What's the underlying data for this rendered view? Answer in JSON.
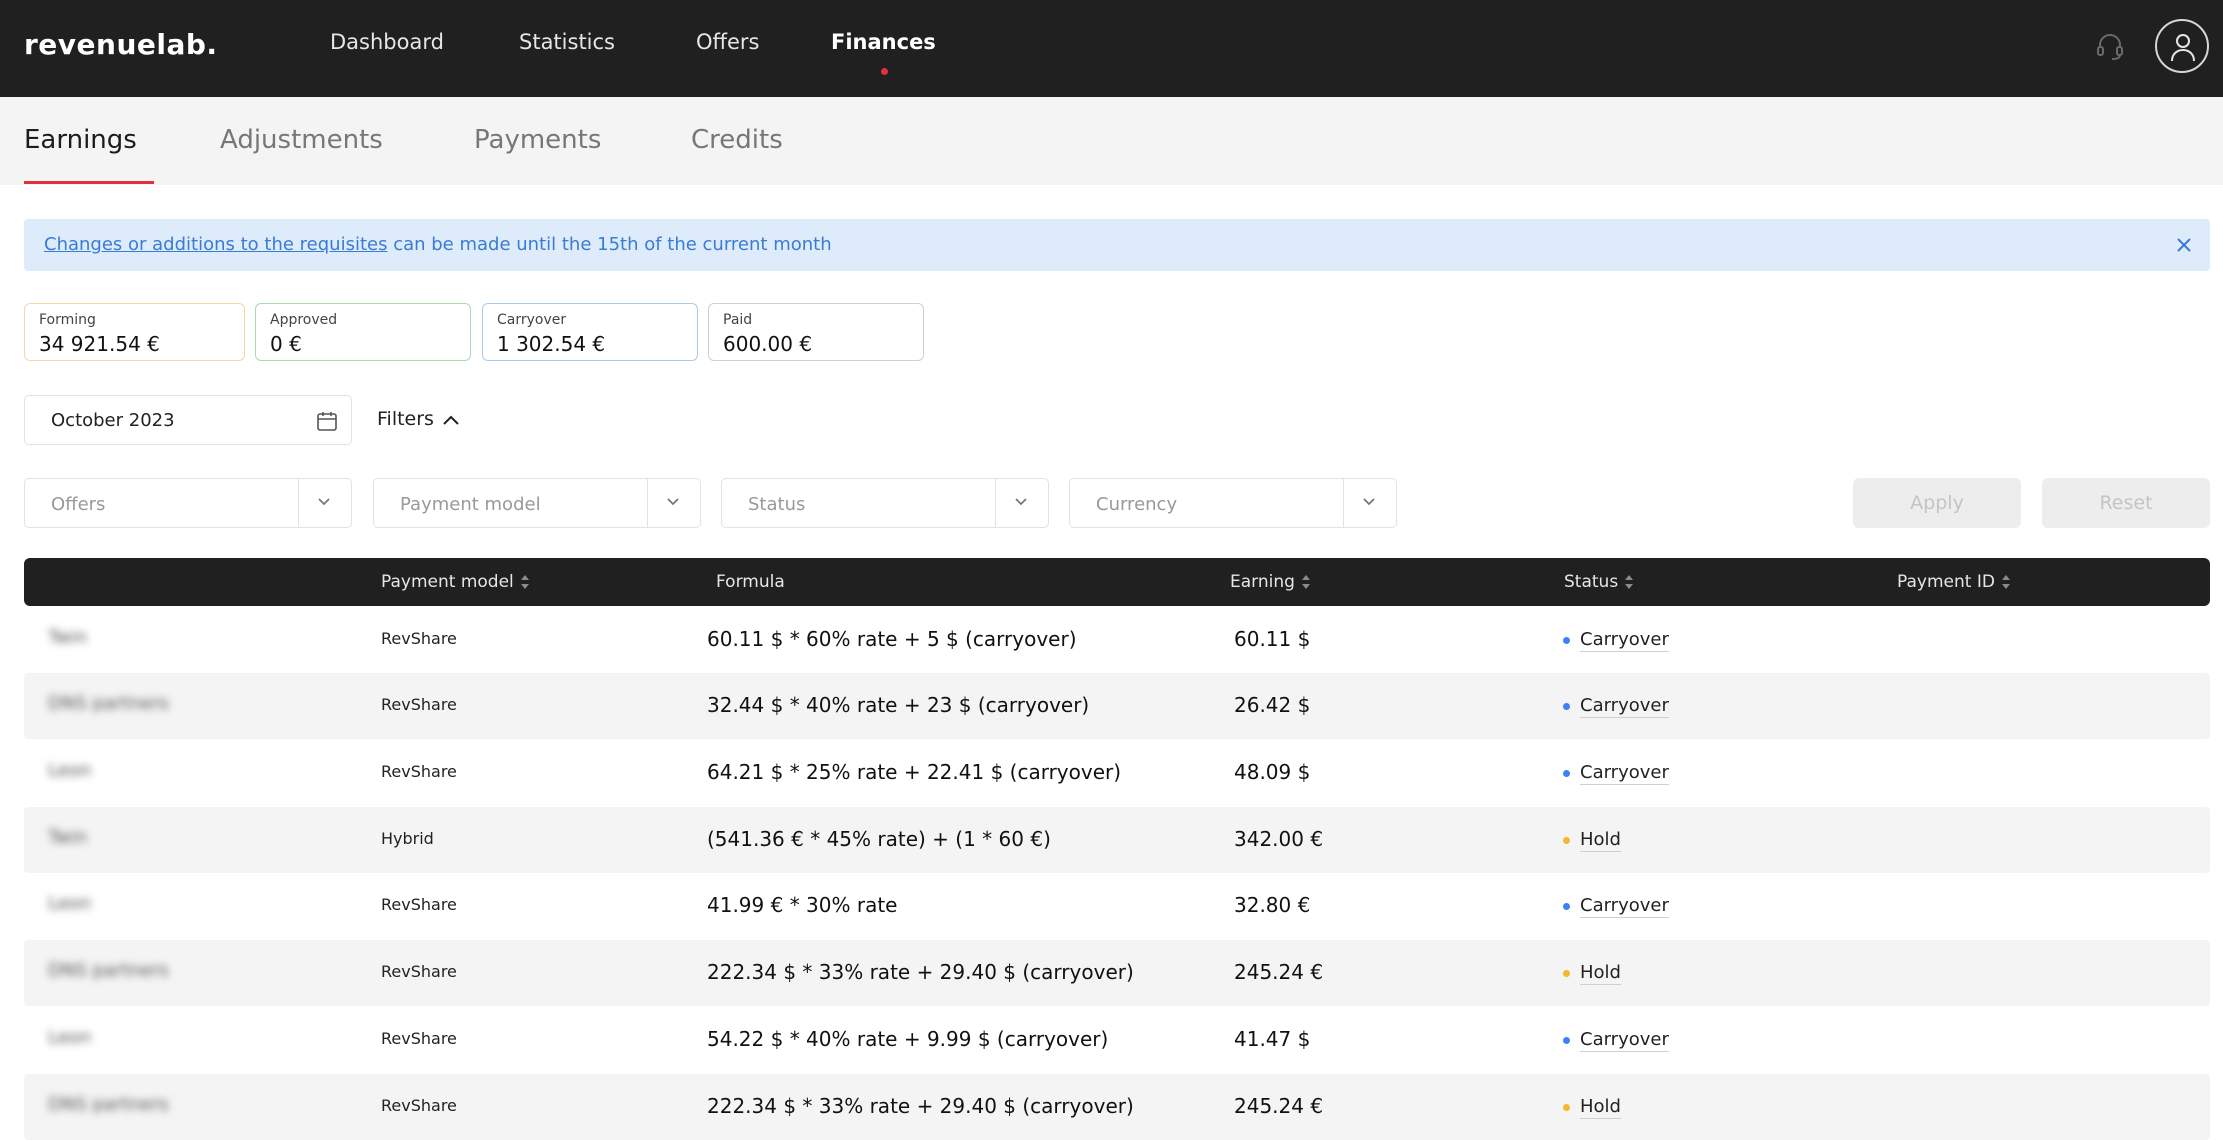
{
  "app": {
    "logo": "revenuelab."
  },
  "nav": {
    "items": [
      "Dashboard",
      "Statistics",
      "Offers",
      "Finances"
    ],
    "active": "Finances"
  },
  "tabs": {
    "items": [
      "Earnings",
      "Adjustments",
      "Payments",
      "Credits"
    ],
    "active": "Earnings"
  },
  "notice": {
    "link": "Changes or additions to the requisites",
    "text": " can be made until the 15th of the current month"
  },
  "summary": [
    {
      "label": "Forming",
      "value": "34 921.54 €",
      "color": "#f4d9a6"
    },
    {
      "label": "Approved",
      "value": "0 €",
      "color": "#a9dcb0"
    },
    {
      "label": "Carryover",
      "value": "1 302.54 €",
      "color": "#a9c9ef"
    },
    {
      "label": "Paid",
      "value": "600.00 €",
      "color": "#cfcfcf"
    }
  ],
  "period": {
    "value": "October 2023"
  },
  "filters": {
    "toggle_label": "Filters",
    "selects": [
      "Offers",
      "Payment model",
      "Status",
      "Currency"
    ],
    "apply_label": "Apply",
    "reset_label": "Reset"
  },
  "table": {
    "columns": [
      "Payment model",
      "Formula",
      "Earning",
      "Status",
      "Payment ID"
    ],
    "rows": [
      {
        "name": "Twin",
        "model": "RevShare",
        "formula": "60.11 $ * 60% rate + 5 $ (carryover)",
        "earning": "60.11 $",
        "status": "Carryover"
      },
      {
        "name": "DNS partners",
        "model": "RevShare",
        "formula": "32.44 $ * 40% rate + 23 $ (carryover)",
        "earning": "26.42 $",
        "status": "Carryover"
      },
      {
        "name": "Leon",
        "model": "RevShare",
        "formula": "64.21 $ * 25% rate + 22.41 $ (carryover)",
        "earning": "48.09 $",
        "status": "Carryover"
      },
      {
        "name": "Twin",
        "model": "Hybrid",
        "formula": "(541.36 € * 45% rate) + (1 * 60 €)",
        "earning": "342.00 €",
        "status": "Hold"
      },
      {
        "name": "Leon",
        "model": "RevShare",
        "formula": "41.99 € * 30% rate",
        "earning": "32.80 €",
        "status": "Carryover"
      },
      {
        "name": "DNS partners",
        "model": "RevShare",
        "formula": "222.34 $ * 33% rate + 29.40 $ (carryover)",
        "earning": "245.24 €",
        "status": "Hold"
      },
      {
        "name": "Leon",
        "model": "RevShare",
        "formula": "54.22 $ * 40% rate + 9.99 $ (carryover)",
        "earning": "41.47 $",
        "status": "Carryover"
      },
      {
        "name": "DNS partners",
        "model": "RevShare",
        "formula": "222.34 $ * 33% rate + 29.40 $ (carryover)",
        "earning": "245.24 €",
        "status": "Hold"
      }
    ]
  },
  "status_colors": {
    "Carryover": "#3b82f6",
    "Hold": "#f5b731"
  },
  "colors": {
    "accent": "#e0313a",
    "header_bg": "#202020",
    "notice_bg": "#ddebfb",
    "notice_text": "#3a7bd5"
  }
}
